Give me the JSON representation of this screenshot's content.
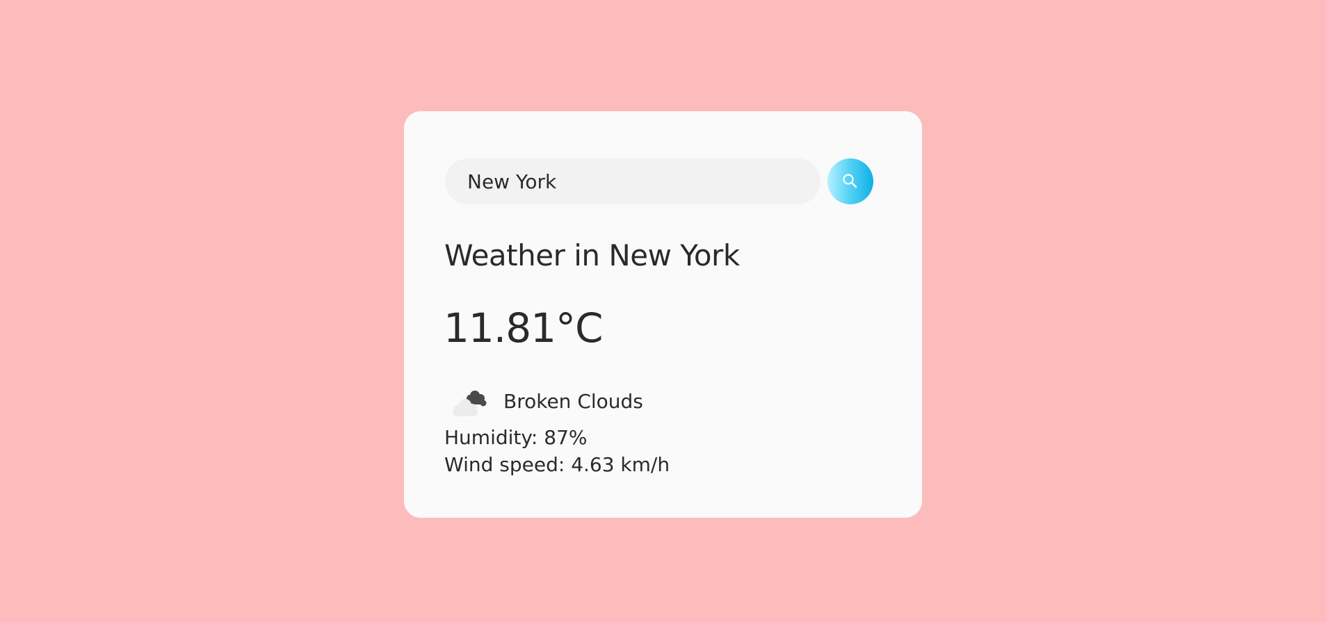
{
  "search": {
    "value": "New York",
    "button_icon": "search-icon"
  },
  "weather": {
    "title": "Weather in New York",
    "temperature": "11.81°C",
    "condition_icon": "broken-clouds-icon",
    "condition": "Broken Clouds",
    "humidity": "Humidity: 87%",
    "wind_speed": "Wind speed: 4.63 km/h"
  },
  "colors": {
    "background": "#fcbcbc",
    "card": "#fafafa",
    "input_background": "#f2f2f2",
    "text": "#2a2a2a",
    "accent_gradient_start": "#b6f0ff",
    "accent_gradient_end": "#0fb0e6"
  }
}
